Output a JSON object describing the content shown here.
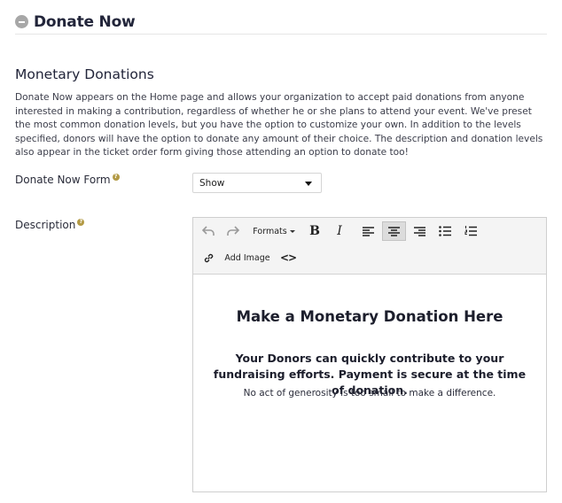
{
  "header": {
    "title": "Donate Now"
  },
  "section": {
    "title": "Monetary Donations",
    "intro": "Donate Now appears on the Home page and allows your organization to accept paid donations from anyone interested in making a contribution, regardless of whether he or she plans to attend your event. We've preset the most common donation levels, but you have the option to customize your own. In addition to the levels specified, donors will have the option to donate any amount of their choice. The description and donation levels also appear in the ticket order form giving those attending an option to donate too!"
  },
  "form": {
    "donate_now_label": "Donate Now Form",
    "donate_now_value": "Show",
    "description_label": "Description"
  },
  "toolbar": {
    "formats_label": "Formats",
    "add_image_label": "Add Image"
  },
  "editor_content": {
    "heading": "Make a Monetary Donation Here",
    "subheading": "Your Donors can quickly contribute to your fundraising efforts. Payment is secure at the time of donation.",
    "note": "No act of generosity is too small to make a difference."
  }
}
